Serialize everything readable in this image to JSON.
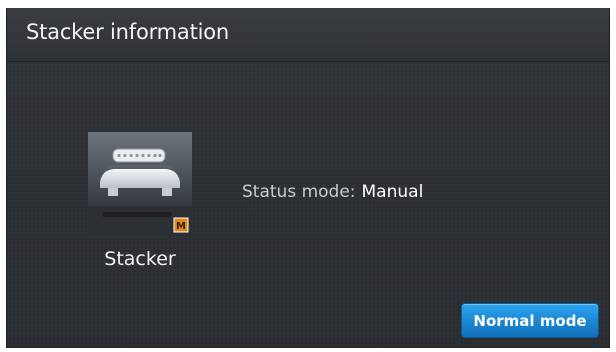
{
  "header": {
    "title": "Stacker information"
  },
  "device": {
    "icon": "stacker-icon",
    "badge": "M",
    "label": "Stacker"
  },
  "status": {
    "label": "Status mode:",
    "value": "Manual"
  },
  "actions": {
    "normal_mode_label": "Normal mode"
  },
  "colors": {
    "background": "#2c2f33",
    "accent": "#1a86d3",
    "badge": "#e38a1b"
  }
}
